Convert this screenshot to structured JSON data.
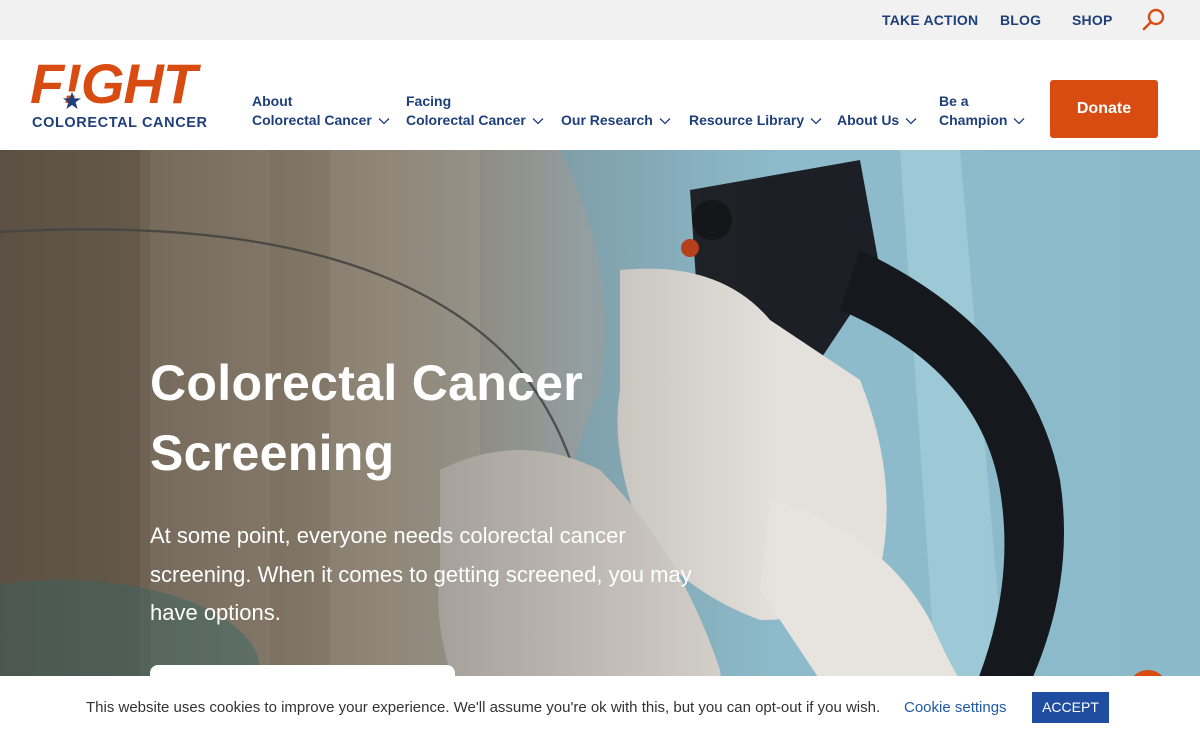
{
  "utility_nav": {
    "take_action": "TAKE ACTION",
    "blog": "BLOG",
    "shop": "SHOP"
  },
  "brand": {
    "name_line1": "F!GHT",
    "name_line2": "COLORECTAL CANCER",
    "colors": {
      "orange": "#d84c12",
      "navy": "#1f3f7a"
    }
  },
  "main_nav": {
    "items": [
      {
        "line1": "About",
        "line2": "Colorectal Cancer"
      },
      {
        "line1": "Facing",
        "line2": "Colorectal Cancer"
      },
      {
        "line1": "",
        "line2": "Our Research"
      },
      {
        "line1": "",
        "line2": "Resource Library"
      },
      {
        "line1": "",
        "line2": "About Us"
      },
      {
        "line1": "Be a",
        "line2": "Champion"
      }
    ],
    "donate_label": "Donate"
  },
  "hero": {
    "title": "Colorectal Cancer Screening",
    "lead": "At some point, everyone needs colorectal cancer screening. When it comes to getting screened, you may have options."
  },
  "cookie_bar": {
    "message": "This website uses cookies to improve your experience. We'll assume you're ok with this, but you can opt-out if you wish.",
    "settings_label": "Cookie settings",
    "accept_label": "ACCEPT"
  },
  "icons": {
    "search": "search-icon",
    "chevron": "chevron-down-icon",
    "star": "star-icon",
    "chat": "chat-icon"
  }
}
